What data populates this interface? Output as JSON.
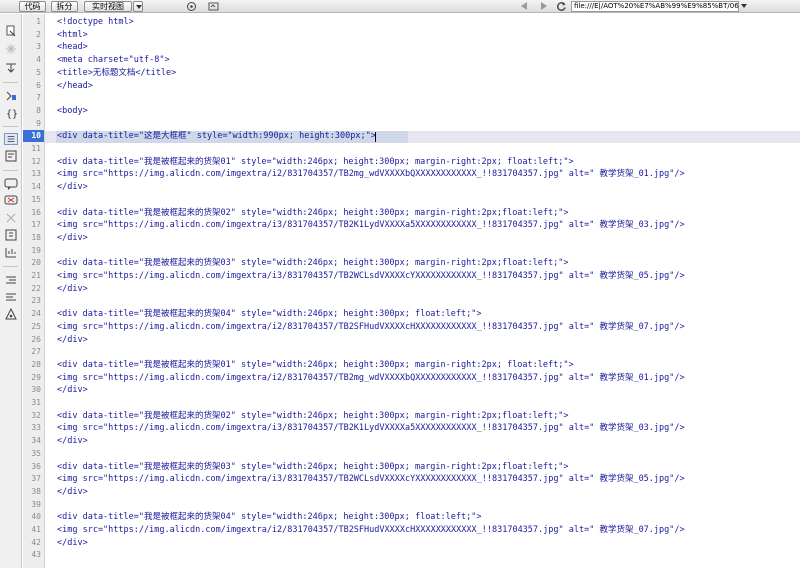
{
  "toolbar": {
    "code_label": "代码",
    "split_label": "拆分",
    "live_view_label": "实时视图",
    "address": "file:///E|/AOT%20%E7%AB%99%E9%85%BT/06",
    "icons": [
      "inspect-icon",
      "refresh-icon",
      "back-arrow-icon",
      "forward-arrow-icon",
      "reload-icon"
    ]
  },
  "sidebar_icons": [
    "open-documents-icon",
    "collapse-tag-icon",
    "expand-all-icon",
    "select-parent-tag-icon",
    "balance-braces-icon",
    "line-numbers-icon",
    "highlight-invalid-icon",
    "apply-comment-icon",
    "remove-comment-icon",
    "wrap-tag-icon",
    "recent-snippets-icon",
    "move-css-icon",
    "indent-code-icon",
    "outdent-code-icon",
    "format-source-icon"
  ],
  "editor": {
    "active_line": 10,
    "lines": [
      {
        "n": "1",
        "text": "<!doctype html>"
      },
      {
        "n": "2",
        "text": "<html>"
      },
      {
        "n": "3",
        "text": "<head>"
      },
      {
        "n": "4",
        "text": "<meta charset=\"utf-8\">"
      },
      {
        "n": "5",
        "text": "<title>无标题文档</title>"
      },
      {
        "n": "6",
        "text": "</head>"
      },
      {
        "n": "7",
        "text": ""
      },
      {
        "n": "8",
        "text": "<body>"
      },
      {
        "n": "9",
        "text": ""
      },
      {
        "n": "10",
        "text": "<div data-title=\"这是大框框\" style=\"width:990px; height:300px;\">"
      },
      {
        "n": "11",
        "text": ""
      },
      {
        "n": "12",
        "text": "<div data-title=\"我是被框起来的货架01\" style=\"width:246px; height:300px; margin-right:2px; float:left;\">"
      },
      {
        "n": "13",
        "text": "<img src=\"https://img.alicdn.com/imgextra/i2/831704357/TB2mg_wdVXXXXbQXXXXXXXXXXXX_!!831704357.jpg\" alt=\" 教学货架_01.jpg\"/>"
      },
      {
        "n": "14",
        "text": "</div>"
      },
      {
        "n": "15",
        "text": ""
      },
      {
        "n": "16",
        "text": "<div data-title=\"我是被框起来的货架02\" style=\"width:246px; height:300px; margin-right:2px;float:left;\">"
      },
      {
        "n": "17",
        "text": "<img src=\"https://img.alicdn.com/imgextra/i3/831704357/TB2K1LydVXXXXa5XXXXXXXXXXXX_!!831704357.jpg\" alt=\" 教学货架_03.jpg\"/>"
      },
      {
        "n": "18",
        "text": "</div>"
      },
      {
        "n": "19",
        "text": ""
      },
      {
        "n": "20",
        "text": "<div data-title=\"我是被框起来的货架03\" style=\"width:246px; height:300px; margin-right:2px;float:left;\">"
      },
      {
        "n": "21",
        "text": "<img src=\"https://img.alicdn.com/imgextra/i3/831704357/TB2WCLsdVXXXXcYXXXXXXXXXXXX_!!831704357.jpg\" alt=\" 教学货架_05.jpg\"/>"
      },
      {
        "n": "22",
        "text": "</div>"
      },
      {
        "n": "23",
        "text": ""
      },
      {
        "n": "24",
        "text": "<div data-title=\"我是被框起来的货架04\" style=\"width:246px; height:300px; float:left;\">"
      },
      {
        "n": "25",
        "text": "<img src=\"https://img.alicdn.com/imgextra/i2/831704357/TB2SFHudVXXXXcHXXXXXXXXXXXX_!!831704357.jpg\" alt=\" 教学货架_07.jpg\"/>"
      },
      {
        "n": "26",
        "text": "</div>"
      },
      {
        "n": "27",
        "text": ""
      },
      {
        "n": "28",
        "text": "<div data-title=\"我是被框起来的货架01\" style=\"width:246px; height:300px; margin-right:2px; float:left;\">"
      },
      {
        "n": "29",
        "text": "<img src=\"https://img.alicdn.com/imgextra/i2/831704357/TB2mg_wdVXXXXbQXXXXXXXXXXXX_!!831704357.jpg\" alt=\" 教学货架_01.jpg\"/>"
      },
      {
        "n": "30",
        "text": "</div>"
      },
      {
        "n": "31",
        "text": ""
      },
      {
        "n": "32",
        "text": "<div data-title=\"我是被框起来的货架02\" style=\"width:246px; height:300px; margin-right:2px;float:left;\">"
      },
      {
        "n": "33",
        "text": "<img src=\"https://img.alicdn.com/imgextra/i3/831704357/TB2K1LydVXXXXa5XXXXXXXXXXXX_!!831704357.jpg\" alt=\" 教学货架_03.jpg\"/>"
      },
      {
        "n": "34",
        "text": "</div>"
      },
      {
        "n": "35",
        "text": ""
      },
      {
        "n": "36",
        "text": "<div data-title=\"我是被框起来的货架03\" style=\"width:246px; height:300px; margin-right:2px;float:left;\">"
      },
      {
        "n": "37",
        "text": "<img src=\"https://img.alicdn.com/imgextra/i3/831704357/TB2WCLsdVXXXXcYXXXXXXXXXXXX_!!831704357.jpg\" alt=\" 教学货架_05.jpg\"/>"
      },
      {
        "n": "38",
        "text": "</div>"
      },
      {
        "n": "39",
        "text": ""
      },
      {
        "n": "40",
        "text": "<div data-title=\"我是被框起来的货架04\" style=\"width:246px; height:300px; float:left;\">"
      },
      {
        "n": "41",
        "text": "<img src=\"https://img.alicdn.com/imgextra/i2/831704357/TB2SFHudVXXXXcHXXXXXXXXXXXX_!!831704357.jpg\" alt=\" 教学货架_07.jpg\"/>"
      },
      {
        "n": "42",
        "text": "</div>"
      },
      {
        "n": "43",
        "text": ""
      }
    ]
  }
}
